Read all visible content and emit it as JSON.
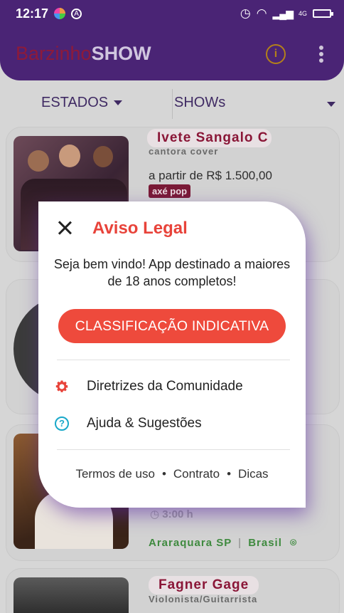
{
  "status_bar": {
    "time": "12:17",
    "network": "4G"
  },
  "app_bar": {
    "logo_part1": "Barzinho",
    "logo_part2": "SHOW",
    "info_icon": "info-icon",
    "menu_icon": "more-vert-icon"
  },
  "filters": {
    "states_label": "ESTADOS",
    "shows_label": "SHOWs"
  },
  "cards": [
    {
      "name": "Ivete Sangalo C",
      "subtitle": "cantora cover",
      "price": "a partir de R$ 1.500,00",
      "genre": "axé pop"
    },
    {
      "time": "3:00 h",
      "city": "Araraquara SP",
      "country": "Brasil"
    },
    {
      "name": "Fagner Gage",
      "subtitle": "Violonista/Guitarrista"
    }
  ],
  "dialog": {
    "title": "Aviso Legal",
    "message": "Seja bem vindo! App destinado a maiores de 18 anos completos!",
    "cta_label": "CLASSIFICAÇÃO INDICATIVA",
    "items": [
      {
        "label": "Diretrizes da Comunidade",
        "icon": "gear-icon"
      },
      {
        "label": "Ajuda & Sugestões",
        "icon": "help-icon"
      }
    ],
    "links": [
      "Termos de uso",
      "Contrato",
      "Dicas"
    ],
    "bullet": "•"
  },
  "colors": {
    "appbar": "#4a2475",
    "accent_red": "#ee4a3c",
    "title_red": "#e8433a",
    "help_cyan": "#19a8c9",
    "location_green": "#3f8a3f"
  }
}
